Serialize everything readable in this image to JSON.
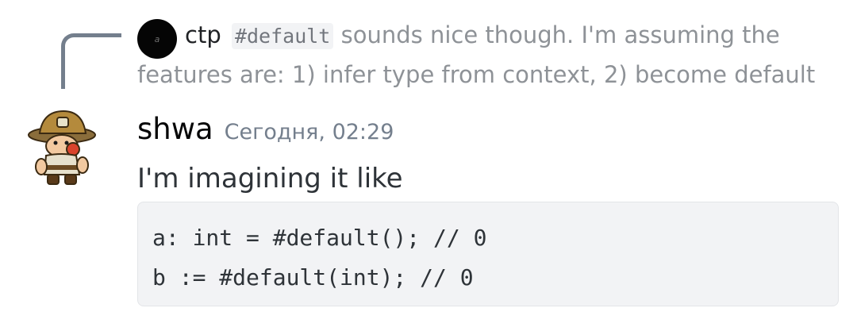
{
  "reply": {
    "author": "ctp",
    "inline_code": "#default",
    "text": " sounds nice though. I'm assuming the features are: 1) infer type from context, 2) become default",
    "avatar_icon": "dark-circle-avatar-icon"
  },
  "message": {
    "author": "shwa",
    "timestamp": "Сегодня, 02:29",
    "text": "I'm imagining it like",
    "avatar_icon": "miner-character-avatar-icon",
    "code_lines": [
      "a: int = #default(); // 0",
      "b := #default(int); // 0"
    ]
  },
  "colors": {
    "reply_text": "#8e9297",
    "username": "#060607",
    "timestamp": "#747f8d",
    "code_background": "#f2f3f5"
  }
}
